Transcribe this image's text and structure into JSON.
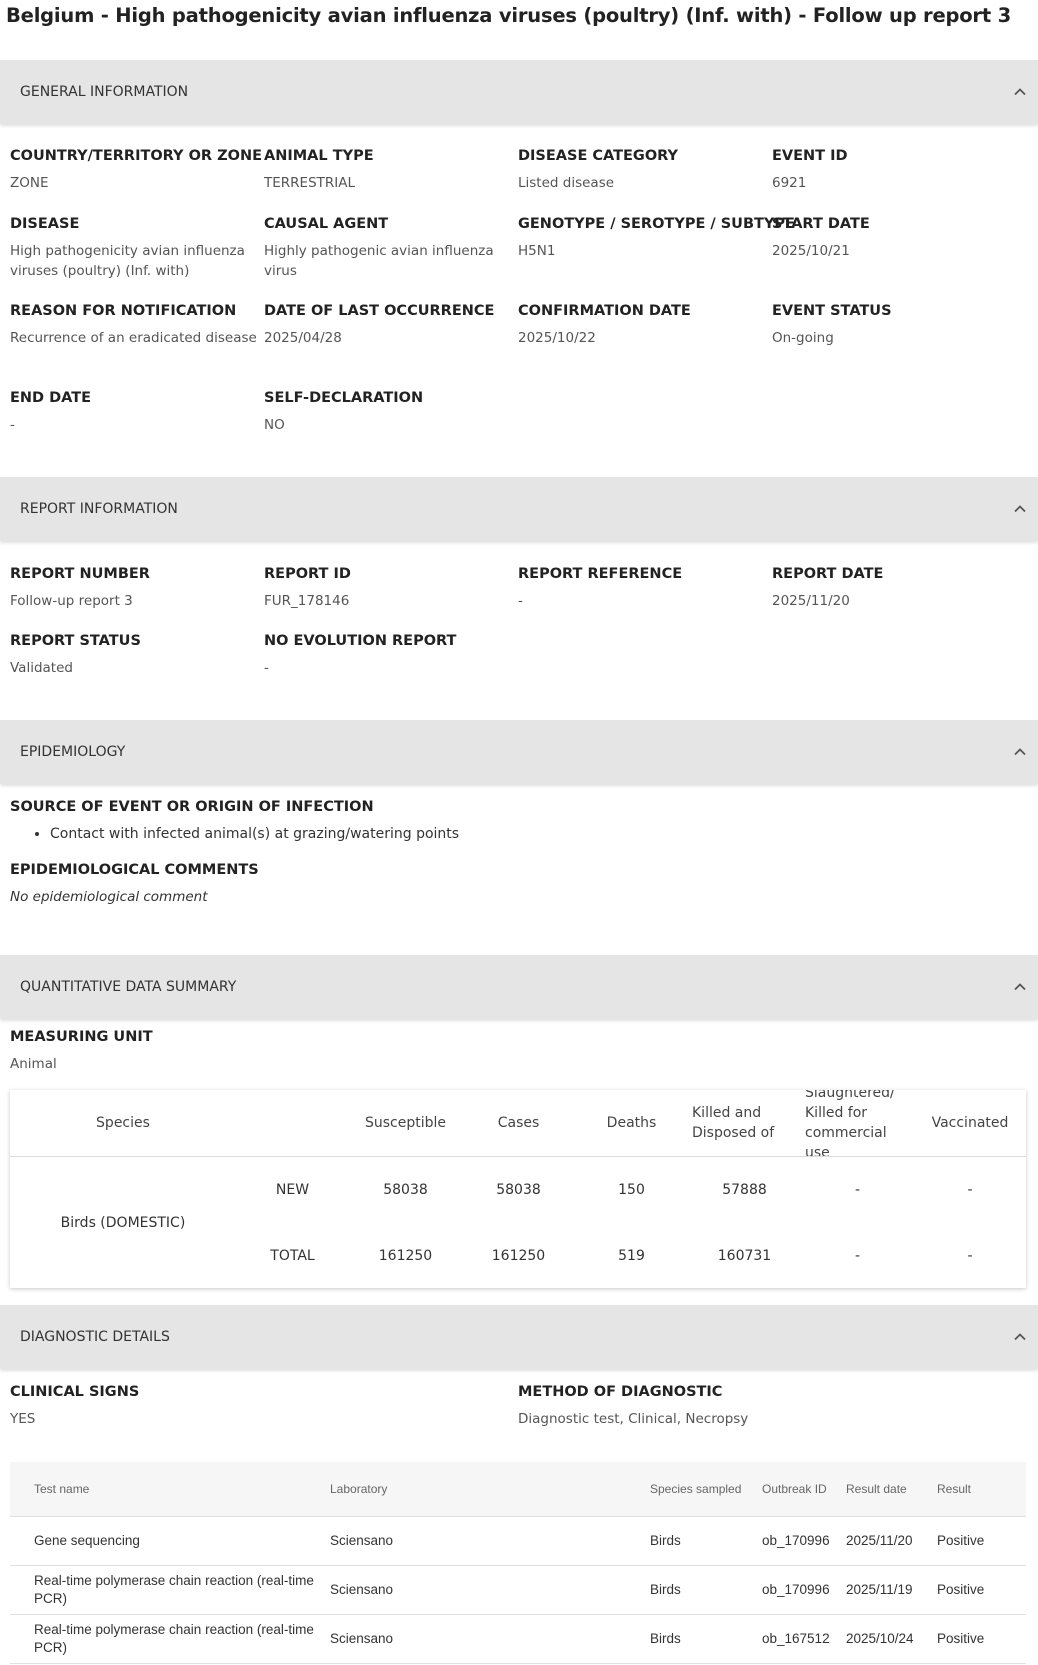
{
  "page_title": "Belgium - High pathogenicity avian influenza viruses (poultry) (Inf. with) - Follow up report 3",
  "sections": {
    "general": "GENERAL INFORMATION",
    "report": "REPORT INFORMATION",
    "epidemiology": "EPIDEMIOLOGY",
    "quantitative": "QUANTITATIVE DATA SUMMARY",
    "diagnostic": "DIAGNOSTIC DETAILS"
  },
  "general": {
    "country_label": "COUNTRY/TERRITORY OR ZONE",
    "country_value": "ZONE",
    "animal_type_label": "ANIMAL TYPE",
    "animal_type_value": "TERRESTRIAL",
    "disease_category_label": "DISEASE CATEGORY",
    "disease_category_value": "Listed disease",
    "event_id_label": "EVENT ID",
    "event_id_value": "6921",
    "disease_label": "DISEASE",
    "disease_value": "High pathogenicity avian influenza viruses (poultry) (Inf. with)",
    "causal_agent_label": "CAUSAL AGENT",
    "causal_agent_value": "Highly pathogenic avian influenza virus",
    "genotype_label": "GENOTYPE / SEROTYPE / SUBTYPE",
    "genotype_value": "H5N1",
    "start_date_label": "START DATE",
    "start_date_value": "2025/10/21",
    "reason_label": "REASON FOR NOTIFICATION",
    "reason_value": "Recurrence of an eradicated disease",
    "last_occurrence_label": "DATE OF LAST OCCURRENCE",
    "last_occurrence_value": "2025/04/28",
    "confirmation_label": "CONFIRMATION DATE",
    "confirmation_value": "2025/10/22",
    "event_status_label": "EVENT STATUS",
    "event_status_value": "On-going",
    "end_date_label": "END DATE",
    "end_date_value": "-",
    "self_declaration_label": "SELF-DECLARATION",
    "self_declaration_value": "NO"
  },
  "report": {
    "number_label": "REPORT NUMBER",
    "number_value": "Follow-up report 3",
    "id_label": "REPORT ID",
    "id_value": "FUR_178146",
    "reference_label": "REPORT REFERENCE",
    "reference_value": "-",
    "date_label": "REPORT DATE",
    "date_value": "2025/11/20",
    "status_label": "REPORT STATUS",
    "status_value": "Validated",
    "no_evolution_label": "NO EVOLUTION REPORT",
    "no_evolution_value": "-"
  },
  "epidemiology": {
    "source_label": "SOURCE OF EVENT OR ORIGIN OF INFECTION",
    "sources": [
      "Contact with infected animal(s) at grazing/watering points"
    ],
    "comments_label": "EPIDEMIOLOGICAL COMMENTS",
    "comments_value": "No epidemiological comment"
  },
  "quantitative": {
    "unit_label": "MEASURING UNIT",
    "unit_value": "Animal",
    "headers": {
      "species": "Species",
      "susceptible": "Susceptible",
      "cases": "Cases",
      "deaths": "Deaths",
      "killed": "Killed and Disposed of",
      "slaughtered": "Slaughtered/ Killed for commercial use",
      "vaccinated": "Vaccinated"
    },
    "species_name": "Birds (DOMESTIC)",
    "rows": [
      {
        "type": "NEW",
        "susceptible": "58038",
        "cases": "58038",
        "deaths": "150",
        "killed": "57888",
        "slaughtered": "-",
        "vaccinated": "-"
      },
      {
        "type": "TOTAL",
        "susceptible": "161250",
        "cases": "161250",
        "deaths": "519",
        "killed": "160731",
        "slaughtered": "-",
        "vaccinated": "-"
      }
    ]
  },
  "diagnostic": {
    "clinical_label": "CLINICAL SIGNS",
    "clinical_value": "YES",
    "method_label": "METHOD OF DIAGNOSTIC",
    "method_value": "Diagnostic test, Clinical, Necropsy",
    "headers": {
      "test": "Test name",
      "lab": "Laboratory",
      "species": "Species sampled",
      "outbreak": "Outbreak ID",
      "date": "Result date",
      "result": "Result"
    },
    "rows": [
      {
        "test": "Gene sequencing",
        "lab": "Sciensano",
        "species": "Birds",
        "outbreak": "ob_170996",
        "date": "2025/11/20",
        "result": "Positive"
      },
      {
        "test": "Real-time polymerase chain reaction (real-time PCR)",
        "lab": "Sciensano",
        "species": "Birds",
        "outbreak": "ob_170996",
        "date": "2025/11/19",
        "result": "Positive"
      },
      {
        "test": "Real-time polymerase chain reaction (real-time PCR)",
        "lab": "Sciensano",
        "species": "Birds",
        "outbreak": "ob_167512",
        "date": "2025/10/24",
        "result": "Positive"
      }
    ]
  },
  "icons": {
    "section_toggle": "chevron-up-icon"
  },
  "colors": {
    "section_header_bg": "#e5e5e5",
    "text_dark": "#222222",
    "text_value": "#555555"
  }
}
